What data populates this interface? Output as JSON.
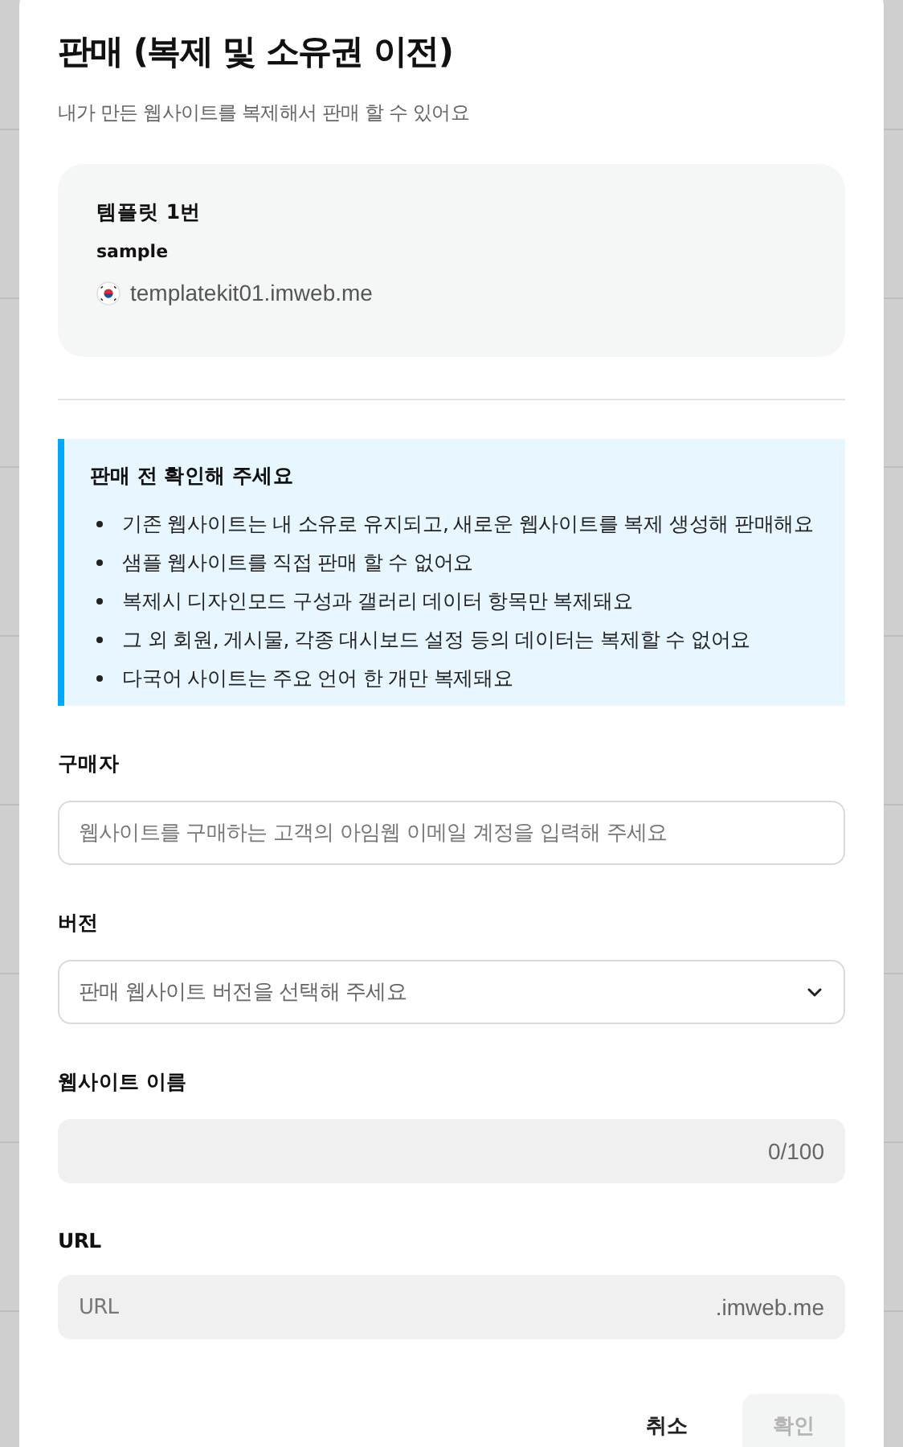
{
  "dialog": {
    "title": "판매 (복제 및 소유권 이전)",
    "subtitle": "내가 만든 웹사이트를 복제해서 판매 할 수 있어요"
  },
  "site_card": {
    "name": "템플릿 1번",
    "label": "sample",
    "url": "templatekit01.imweb.me"
  },
  "notice": {
    "title": "판매 전 확인해 주세요",
    "items": [
      "기존 웹사이트는 내 소유로 유지되고, 새로운 웹사이트를 복제 생성해 판매해요",
      "샘플 웹사이트를 직접 판매 할 수 없어요",
      "복제시 디자인모드 구성과 갤러리 데이터 항목만 복제돼요",
      "그 외 회원, 게시물, 각종 대시보드 설정 등의 데이터는 복제할 수 없어요",
      "다국어 사이트는 주요 언어 한 개만 복제돼요"
    ]
  },
  "fields": [
    {
      "kind": "text",
      "label": "구매자",
      "placeholder": "웹사이트를 구매하는 고객의 아임웹 이메일 계정을 입력해 주세요",
      "disabled": false
    },
    {
      "kind": "select",
      "label": "버전",
      "placeholder": "판매 웹사이트 버전을 선택해 주세요",
      "disabled": false
    },
    {
      "kind": "counter",
      "label": "웹사이트 이름",
      "counter": "0/100",
      "disabled": true
    },
    {
      "kind": "suffix",
      "label": "URL",
      "placeholder": "URL",
      "suffix": ".imweb.me",
      "disabled": true
    }
  ],
  "buttons": [
    {
      "label": "취소",
      "kind": "cancel"
    },
    {
      "label": "확인",
      "kind": "confirm",
      "disabled": true
    }
  ]
}
